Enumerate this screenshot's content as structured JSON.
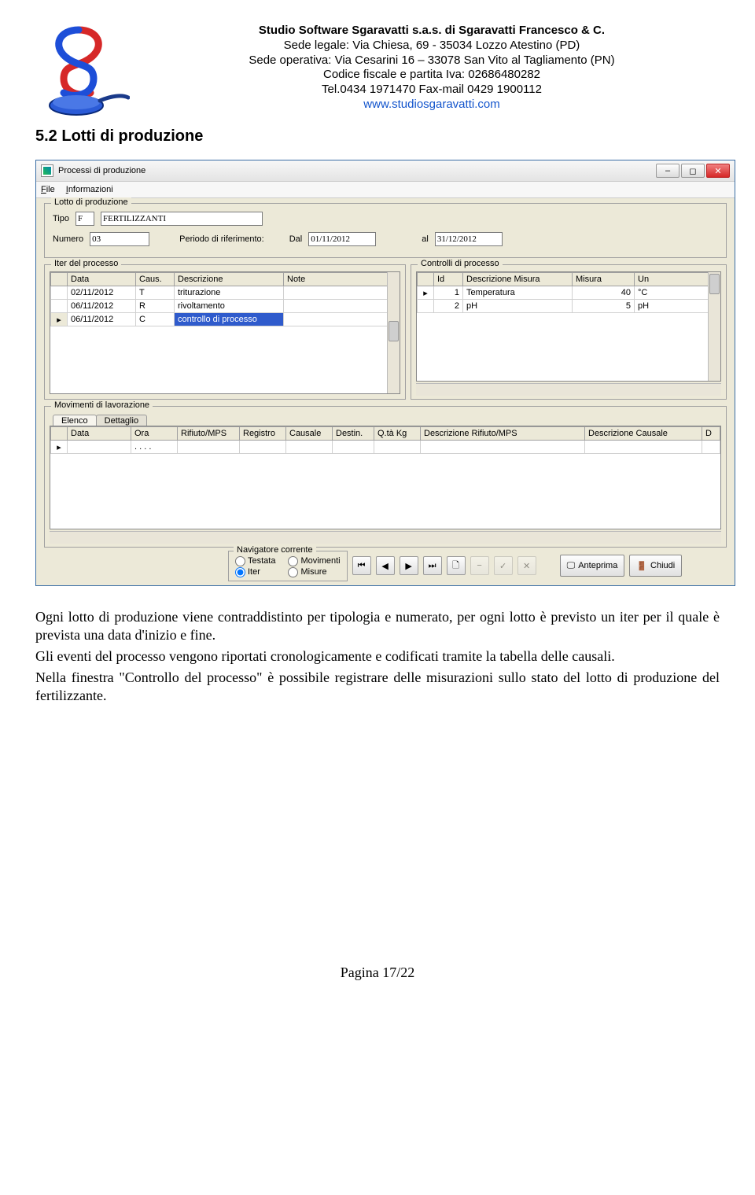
{
  "header": {
    "line1": "Studio Software Sgaravatti s.a.s. di Sgaravatti Francesco & C.",
    "line2": "Sede legale: Via Chiesa, 69 - 35034 Lozzo Atestino (PD)",
    "line3": "Sede operativa: Via Cesarini 16 – 33078 San Vito al Tagliamento (PN)",
    "line4": "Codice fiscale e partita Iva: 02686480282",
    "line5": "Tel.0434 1971470 Fax-mail 0429 1900112",
    "link": "www.studiosgaravatti.com"
  },
  "section_title": "5.2 Lotti di produzione",
  "win": {
    "title": "Processi di produzione",
    "menu_file": "File",
    "menu_info": "Informazioni",
    "grp_lotto": "Lotto di produzione",
    "lbl_tipo": "Tipo",
    "tipo_code": "F",
    "tipo_desc": "FERTILIZZANTI",
    "lbl_numero": "Numero",
    "numero": "03",
    "lbl_periodo": "Periodo di riferimento:",
    "lbl_dal": "Dal",
    "dal": "01/11/2012",
    "lbl_al": "al",
    "al": "31/12/2012",
    "grp_iter": "Iter del processo",
    "iter_cols": [
      "",
      "Data",
      "Caus.",
      "Descrizione",
      "Note"
    ],
    "iter_rows": [
      {
        "ptr": "",
        "data": "02/11/2012",
        "caus": "T",
        "desc": "triturazione",
        "note": ""
      },
      {
        "ptr": "",
        "data": "06/11/2012",
        "caus": "R",
        "desc": "rivoltamento",
        "note": ""
      },
      {
        "ptr": "▸",
        "data": "06/11/2012",
        "caus": "C",
        "desc": "controllo di processo",
        "note": "",
        "sel": true
      }
    ],
    "grp_ctrl": "Controlli di processo",
    "ctrl_cols": [
      "",
      "Id",
      "Descrizione Misura",
      "Misura",
      "Un"
    ],
    "ctrl_rows": [
      {
        "ptr": "▸",
        "id": "1",
        "desc": "Temperatura",
        "mis": "40",
        "un": "°C"
      },
      {
        "ptr": "",
        "id": "2",
        "desc": "pH",
        "mis": "5",
        "un": "pH"
      }
    ],
    "grp_mov": "Movimenti di lavorazione",
    "tab_elenco": "Elenco",
    "tab_dettaglio": "Dettaglio",
    "mov_cols": [
      "",
      "Data",
      "Ora",
      "Rifiuto/MPS",
      "Registro",
      "Causale",
      "Destin.",
      "Q.tà Kg",
      "Descrizione Rifiuto/MPS",
      "Descrizione Causale",
      "D"
    ],
    "mov_row": {
      "ptr": "▸",
      "ora": ". .  . ."
    },
    "nav_title": "Navigatore corrente",
    "nav_testata": "Testata",
    "nav_movimenti": "Movimenti",
    "nav_iter": "Iter",
    "nav_misure": "Misure",
    "btn_anteprima": "Anteprima",
    "btn_chiudi": "Chiudi"
  },
  "para1": "Ogni lotto di produzione viene contraddistinto per tipologia e numerato, per ogni lotto è previsto un iter per il quale è prevista una data d'inizio e fine.",
  "para2": "Gli eventi del processo vengono riportati cronologicamente e codificati tramite la tabella delle causali.",
  "para3": "Nella finestra \"Controllo del processo\" è possibile registrare delle misurazioni sullo stato del lotto di produzione del fertilizzante.",
  "footer": "Pagina 17/22"
}
